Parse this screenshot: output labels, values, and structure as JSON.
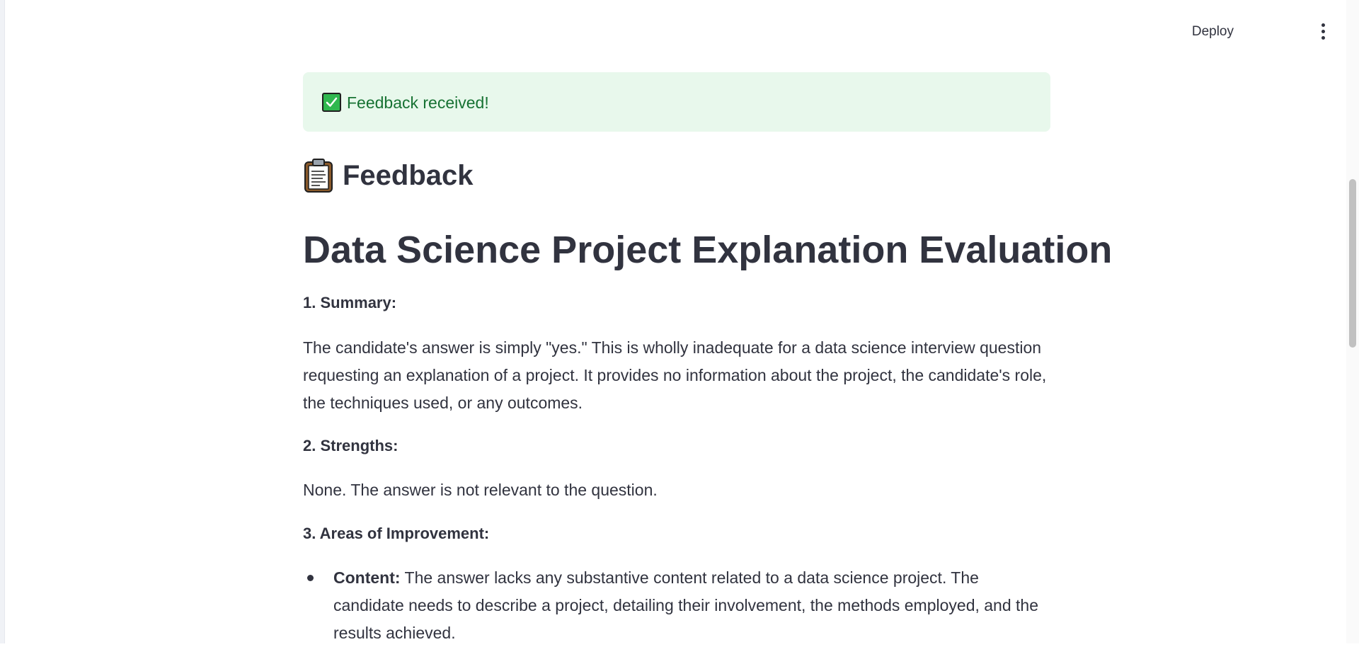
{
  "header": {
    "deploy_label": "Deploy",
    "menu_icon": "kebab-menu-icon"
  },
  "alert": {
    "icon": "check-mark-icon",
    "text": "Feedback received!",
    "bg_color": "#e8f8ec",
    "text_color": "#177233"
  },
  "feedback": {
    "icon": "clipboard-icon",
    "title": "Feedback"
  },
  "report": {
    "title": "Data Science Project Explanation Evaluation",
    "sections": [
      {
        "heading": "1. Summary:",
        "body": "The candidate's answer is simply \"yes.\" This is wholly inadequate for a data science interview question requesting an explanation of a project. It provides no information about the project, the candidate's role, the techniques used, or any outcomes."
      },
      {
        "heading": "2. Strengths:",
        "body": "None. The answer is not relevant to the question."
      },
      {
        "heading": "3. Areas of Improvement:",
        "bullets": [
          {
            "label": "Content:",
            "text": "The answer lacks any substantive content related to a data science project. The candidate needs to describe a project, detailing their involvement, the methods employed, and the results achieved."
          }
        ]
      }
    ]
  }
}
